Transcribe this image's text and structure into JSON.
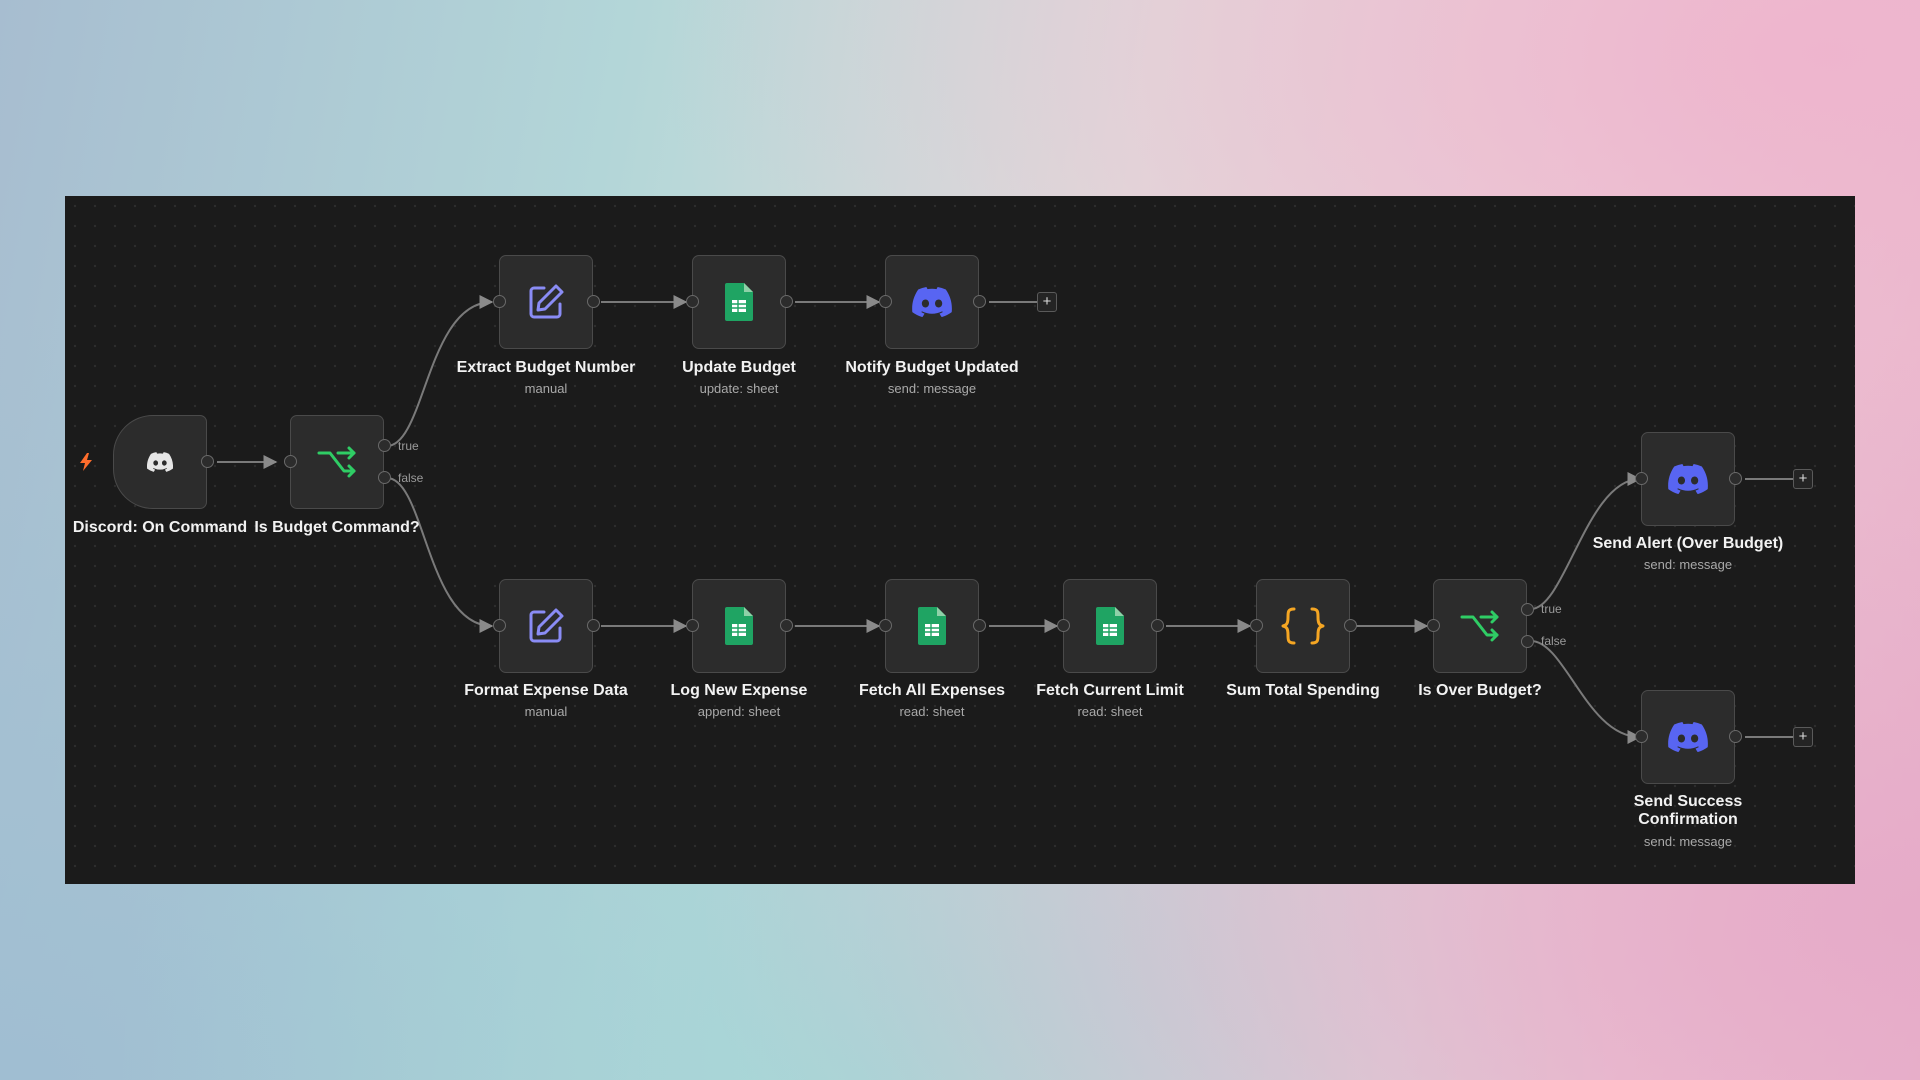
{
  "colors": {
    "canvas_bg": "#1b1b1b",
    "node_bg": "#2c2c2c",
    "discord_brand": "#5865f2",
    "sheets_green": "#1fa463",
    "if_green": "#2fcd65",
    "set_purple": "#8a8cf5",
    "code_orange": "#f5a623",
    "trigger_bolt": "#ff6d2c"
  },
  "nodes": {
    "discord_on_command": {
      "title": "Discord: On Command",
      "icon": "discord-icon"
    },
    "is_budget_command": {
      "title": "Is Budget Command?",
      "icon": "if-branch-icon",
      "true_label": "true",
      "false_label": "false"
    },
    "extract_budget_number": {
      "title": "Extract Budget Number",
      "subtitle": "manual",
      "icon": "edit-pencil-icon"
    },
    "update_budget": {
      "title": "Update Budget",
      "subtitle": "update: sheet",
      "icon": "google-sheets-icon"
    },
    "notify_budget_updated": {
      "title": "Notify Budget Updated",
      "subtitle": "send: message",
      "icon": "discord-icon"
    },
    "format_expense_data": {
      "title": "Format Expense Data",
      "subtitle": "manual",
      "icon": "edit-pencil-icon"
    },
    "log_new_expense": {
      "title": "Log New Expense",
      "subtitle": "append: sheet",
      "icon": "google-sheets-icon"
    },
    "fetch_all_expenses": {
      "title": "Fetch All Expenses",
      "subtitle": "read: sheet",
      "icon": "google-sheets-icon"
    },
    "fetch_current_limit": {
      "title": "Fetch Current Limit",
      "subtitle": "read: sheet",
      "icon": "google-sheets-icon"
    },
    "sum_total_spending": {
      "title": "Sum Total Spending",
      "icon": "code-braces-icon"
    },
    "is_over_budget": {
      "title": "Is Over Budget?",
      "icon": "if-branch-icon",
      "true_label": "true",
      "false_label": "false"
    },
    "send_alert": {
      "title": "Send Alert (Over Budget)",
      "subtitle": "send: message",
      "icon": "discord-icon"
    },
    "send_success": {
      "title": "Send Success Confirmation",
      "subtitle": "send: message",
      "icon": "discord-icon"
    }
  },
  "add_button_label": "+"
}
